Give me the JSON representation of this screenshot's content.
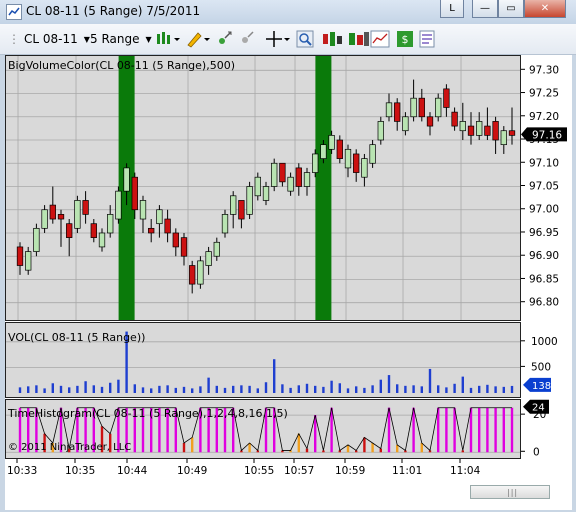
{
  "window": {
    "title": "CL 08-11 (5 Range)  7/5/2011",
    "layout_button": "L",
    "minimize_glyph": "—",
    "restore_glyph": "▭",
    "close_glyph": "✕"
  },
  "toolbar": {
    "instrument": "CL 08-11",
    "period": "5 Range",
    "icons": [
      "bar-type-icon",
      "pencil-draw-icon",
      "zoom-in-icon",
      "crosshair-icon",
      "search-magnify-icon",
      "instrument-overlay-icon",
      "chart-style-icon",
      "dollar-icon",
      "properties-icon"
    ]
  },
  "colors": {
    "up": "#b9e4b2",
    "down": "#cc1111",
    "volume": "#1f3fd0",
    "big_volume": "#0a7a0a",
    "tih": "#e000e0",
    "accent_badge": "#0a3fd0"
  },
  "panels": {
    "price_label": "BigVolumeColor(CL 08-11 (5 Range),500)",
    "volume_label": "VOL(CL 08-11 (5 Range))",
    "tih_label": "TimeHistogram(CL 08-11 (5 Range),1,2,4,8,16,1,5)",
    "copyright": "© 2011 NinjaTrader, LLC",
    "price_last": "97.16",
    "volume_last": "138",
    "tih_last": "24"
  },
  "chart_data": [
    {
      "type": "candlestick",
      "title": "BigVolumeColor(CL 08-11 (5 Range),500)",
      "ylim": [
        96.78,
        97.32
      ],
      "y_ticks": [
        "97.30",
        "97.20",
        "97.10",
        "97.00",
        "96.90",
        "96.80"
      ],
      "y_ticks_extra": [
        "97.25",
        "97.15",
        "97.05",
        "96.95",
        "96.85"
      ],
      "big_volume_bars": [
        13,
        37
      ],
      "last_price": 97.16,
      "bars": [
        {
          "o": 96.92,
          "c": 96.88,
          "h": 96.93,
          "l": 96.86
        },
        {
          "o": 96.87,
          "c": 96.91,
          "h": 96.92,
          "l": 96.86
        },
        {
          "o": 96.91,
          "c": 96.96,
          "h": 96.97,
          "l": 96.9
        },
        {
          "o": 96.96,
          "c": 97.0,
          "h": 97.01,
          "l": 96.95
        },
        {
          "o": 97.01,
          "c": 96.98,
          "h": 97.05,
          "l": 96.97
        },
        {
          "o": 96.99,
          "c": 96.98,
          "h": 97.0,
          "l": 96.92
        },
        {
          "o": 96.97,
          "c": 96.94,
          "h": 96.98,
          "l": 96.9
        },
        {
          "o": 96.96,
          "c": 97.02,
          "h": 97.03,
          "l": 96.95
        },
        {
          "o": 97.02,
          "c": 96.99,
          "h": 97.04,
          "l": 96.97
        },
        {
          "o": 96.97,
          "c": 96.94,
          "h": 96.98,
          "l": 96.93
        },
        {
          "o": 96.92,
          "c": 96.95,
          "h": 96.96,
          "l": 96.91
        },
        {
          "o": 96.95,
          "c": 96.99,
          "h": 97.01,
          "l": 96.94
        },
        {
          "o": 96.98,
          "c": 97.04,
          "h": 97.05,
          "l": 96.97
        },
        {
          "o": 97.04,
          "c": 97.09,
          "h": 97.1,
          "l": 97.01
        },
        {
          "o": 97.07,
          "c": 97.0,
          "h": 97.08,
          "l": 96.98
        },
        {
          "o": 96.98,
          "c": 97.02,
          "h": 97.03,
          "l": 96.95
        },
        {
          "o": 96.96,
          "c": 96.95,
          "h": 96.98,
          "l": 96.93
        },
        {
          "o": 96.97,
          "c": 97.0,
          "h": 97.01,
          "l": 96.94
        },
        {
          "o": 96.98,
          "c": 96.95,
          "h": 97.0,
          "l": 96.93
        },
        {
          "o": 96.95,
          "c": 96.92,
          "h": 96.96,
          "l": 96.9
        },
        {
          "o": 96.94,
          "c": 96.9,
          "h": 96.95,
          "l": 96.88
        },
        {
          "o": 96.88,
          "c": 96.84,
          "h": 96.89,
          "l": 96.82
        },
        {
          "o": 96.84,
          "c": 96.89,
          "h": 96.9,
          "l": 96.83
        },
        {
          "o": 96.88,
          "c": 96.91,
          "h": 96.92,
          "l": 96.86
        },
        {
          "o": 96.9,
          "c": 96.93,
          "h": 96.94,
          "l": 96.89
        },
        {
          "o": 96.95,
          "c": 96.99,
          "h": 97.0,
          "l": 96.94
        },
        {
          "o": 96.99,
          "c": 97.03,
          "h": 97.04,
          "l": 96.96
        },
        {
          "o": 97.02,
          "c": 96.98,
          "h": 97.02,
          "l": 96.96
        },
        {
          "o": 96.99,
          "c": 97.05,
          "h": 97.06,
          "l": 96.98
        },
        {
          "o": 97.03,
          "c": 97.07,
          "h": 97.08,
          "l": 97.02
        },
        {
          "o": 97.02,
          "c": 97.05,
          "h": 97.06,
          "l": 97.01
        },
        {
          "o": 97.05,
          "c": 97.1,
          "h": 97.11,
          "l": 97.04
        },
        {
          "o": 97.1,
          "c": 97.06,
          "h": 97.1,
          "l": 97.05
        },
        {
          "o": 97.04,
          "c": 97.07,
          "h": 97.08,
          "l": 97.03
        },
        {
          "o": 97.09,
          "c": 97.05,
          "h": 97.1,
          "l": 97.03
        },
        {
          "o": 97.05,
          "c": 97.08,
          "h": 97.09,
          "l": 97.03
        },
        {
          "o": 97.08,
          "c": 97.12,
          "h": 97.13,
          "l": 97.07
        },
        {
          "o": 97.11,
          "c": 97.14,
          "h": 97.15,
          "l": 97.1
        },
        {
          "o": 97.13,
          "c": 97.16,
          "h": 97.17,
          "l": 97.12
        },
        {
          "o": 97.15,
          "c": 97.11,
          "h": 97.16,
          "l": 97.1
        },
        {
          "o": 97.09,
          "c": 97.13,
          "h": 97.14,
          "l": 97.07
        },
        {
          "o": 97.12,
          "c": 97.08,
          "h": 97.13,
          "l": 97.06
        },
        {
          "o": 97.07,
          "c": 97.11,
          "h": 97.12,
          "l": 97.05
        },
        {
          "o": 97.1,
          "c": 97.14,
          "h": 97.15,
          "l": 97.09
        },
        {
          "o": 97.15,
          "c": 97.19,
          "h": 97.2,
          "l": 97.14
        },
        {
          "o": 97.2,
          "c": 97.23,
          "h": 97.25,
          "l": 97.19
        },
        {
          "o": 97.23,
          "c": 97.19,
          "h": 97.24,
          "l": 97.17
        },
        {
          "o": 97.17,
          "c": 97.2,
          "h": 97.21,
          "l": 97.16
        },
        {
          "o": 97.2,
          "c": 97.24,
          "h": 97.28,
          "l": 97.19
        },
        {
          "o": 97.24,
          "c": 97.2,
          "h": 97.26,
          "l": 97.19
        },
        {
          "o": 97.2,
          "c": 97.18,
          "h": 97.21,
          "l": 97.16
        },
        {
          "o": 97.2,
          "c": 97.24,
          "h": 97.25,
          "l": 97.19
        },
        {
          "o": 97.26,
          "c": 97.22,
          "h": 97.27,
          "l": 97.2
        },
        {
          "o": 97.21,
          "c": 97.18,
          "h": 97.22,
          "l": 97.17
        },
        {
          "o": 97.17,
          "c": 97.19,
          "h": 97.23,
          "l": 97.15
        },
        {
          "o": 97.18,
          "c": 97.16,
          "h": 97.21,
          "l": 97.14
        },
        {
          "o": 97.16,
          "c": 97.19,
          "h": 97.21,
          "l": 97.15
        },
        {
          "o": 97.18,
          "c": 97.16,
          "h": 97.22,
          "l": 97.15
        },
        {
          "o": 97.19,
          "c": 97.15,
          "h": 97.2,
          "l": 97.12
        },
        {
          "o": 97.14,
          "c": 97.17,
          "h": 97.18,
          "l": 97.12
        },
        {
          "o": 97.17,
          "c": 97.16,
          "h": 97.22,
          "l": 97.14
        }
      ]
    },
    {
      "type": "bar",
      "title": "VOL(CL 08-11 (5 Range))",
      "ylim": [
        0,
        1250
      ],
      "y_ticks": [
        "1000",
        "500"
      ],
      "last_value": 138,
      "values": [
        110,
        130,
        150,
        90,
        190,
        140,
        110,
        140,
        230,
        150,
        120,
        200,
        260,
        1200,
        170,
        110,
        90,
        140,
        150,
        100,
        120,
        90,
        130,
        300,
        140,
        100,
        140,
        150,
        140,
        90,
        210,
        660,
        170,
        100,
        150,
        180,
        140,
        120,
        240,
        190,
        90,
        130,
        100,
        150,
        260,
        350,
        170,
        140,
        150,
        130,
        470,
        150,
        110,
        180,
        320,
        100,
        140,
        160,
        130,
        120,
        138
      ]
    },
    {
      "type": "bar",
      "title": "TimeHistogram(CL 08-11 (5 Range),1,2,4,8,16,1,5)",
      "ylim": [
        -2,
        26
      ],
      "y_ticks": [
        "20",
        "0"
      ],
      "last_value": 24,
      "values": [
        24,
        24,
        24,
        10,
        5,
        24,
        2,
        24,
        24,
        24,
        14,
        10,
        24,
        24,
        24,
        24,
        24,
        24,
        24,
        24,
        5,
        8,
        24,
        24,
        24,
        24,
        24,
        1,
        5,
        1,
        24,
        24,
        1,
        1,
        10,
        2,
        20,
        1,
        24,
        1,
        4,
        1,
        8,
        5,
        2,
        24,
        4,
        1,
        24,
        5,
        1,
        24,
        24,
        24,
        1,
        24,
        24,
        24,
        24,
        24,
        24,
        24
      ],
      "band_colors": [
        "m",
        "m",
        "m",
        "r",
        "o",
        "m",
        "r",
        "m",
        "m",
        "m",
        "r",
        "r",
        "m",
        "m",
        "m",
        "m",
        "m",
        "m",
        "m",
        "m",
        "r",
        "o",
        "m",
        "m",
        "m",
        "m",
        "m",
        "r",
        "o",
        "r",
        "m",
        "m",
        "r",
        "o",
        "o",
        "r",
        "m",
        "r",
        "m",
        "r",
        "o",
        "r",
        "r",
        "o",
        "r",
        "m",
        "o",
        "r",
        "m",
        "o",
        "r",
        "m",
        "m",
        "m",
        "r",
        "m",
        "m",
        "m",
        "m",
        "m",
        "m",
        "m"
      ]
    }
  ],
  "time_axis": [
    "10:33",
    "10:35",
    "10:44",
    "10:49",
    "10:55",
    "10:57",
    "10:59",
    "11:01",
    "11:04"
  ]
}
